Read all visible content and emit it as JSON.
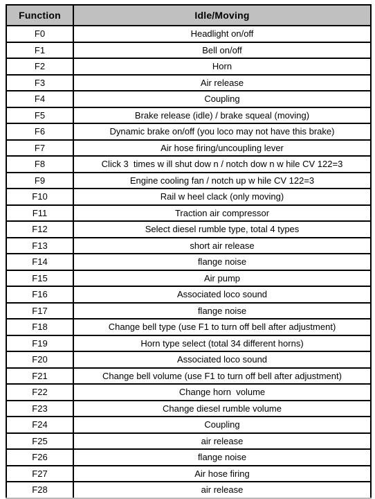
{
  "document": {
    "type": "function-mapping-table",
    "background_color": "#ffffff",
    "border_color": "#000000",
    "header_fill_color": "#c0c0c0"
  },
  "table": {
    "columns": [
      {
        "key": "function",
        "label": "Function"
      },
      {
        "key": "description",
        "label": "Idle/Moving"
      }
    ],
    "rows": [
      {
        "function": "F0",
        "description": "Headlight on/off"
      },
      {
        "function": "F1",
        "description": "Bell on/off"
      },
      {
        "function": "F2",
        "description": "Horn"
      },
      {
        "function": "F3",
        "description": "Air release"
      },
      {
        "function": "F4",
        "description": "Coupling"
      },
      {
        "function": "F5",
        "description": "Brake release (idle) / brake squeal (moving)"
      },
      {
        "function": "F6",
        "description": "Dynamic brake on/off (you loco may not have this brake)"
      },
      {
        "function": "F7",
        "description": "Air hose firing/uncoupling lever"
      },
      {
        "function": "F8",
        "description": "Click 3  times w ill shut dow n / notch dow n w hile CV 122=3"
      },
      {
        "function": "F9",
        "description": "Engine cooling fan / notch up w hile CV 122=3"
      },
      {
        "function": "F10",
        "description": "Rail w heel clack (only moving)"
      },
      {
        "function": "F11",
        "description": "Traction air compressor"
      },
      {
        "function": "F12",
        "description": "Select diesel rumble type, total 4 types"
      },
      {
        "function": "F13",
        "description": "short air release"
      },
      {
        "function": "F14",
        "description": "flange noise"
      },
      {
        "function": "F15",
        "description": "Air pump"
      },
      {
        "function": "F16",
        "description": "Associated loco sound"
      },
      {
        "function": "F17",
        "description": "flange noise"
      },
      {
        "function": "F18",
        "description": "Change bell type (use F1 to turn off bell after adjustment)"
      },
      {
        "function": "F19",
        "description": "Horn type select (total 34 different horns)"
      },
      {
        "function": "F20",
        "description": "Associated loco sound"
      },
      {
        "function": "F21",
        "description": "Change bell volume (use F1 to turn off bell after adjustment)"
      },
      {
        "function": "F22",
        "description": "Change horn  volume"
      },
      {
        "function": "F23",
        "description": "Change diesel rumble volume"
      },
      {
        "function": "F24",
        "description": "Coupling"
      },
      {
        "function": "F25",
        "description": "air release"
      },
      {
        "function": "F26",
        "description": "flange noise"
      },
      {
        "function": "F27",
        "description": "Air hose firing"
      },
      {
        "function": "F28",
        "description": "air release"
      }
    ]
  }
}
